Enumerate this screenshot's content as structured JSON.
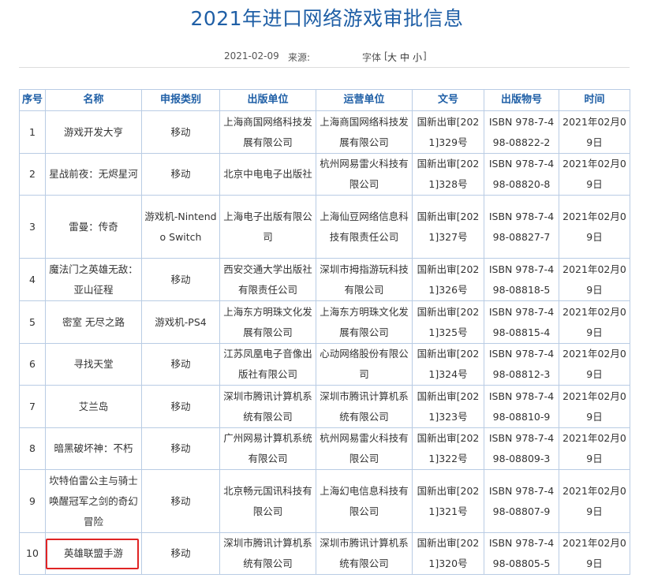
{
  "article": {
    "title": "2021年进口网络游戏审批信息",
    "date": "2021-02-09",
    "source_label": "来源:",
    "font_label": "字体",
    "font_open": "[",
    "font_large": "大",
    "font_medium": "中",
    "font_small": "小",
    "font_close": "]"
  },
  "table": {
    "headers": [
      "序号",
      "名称",
      "申报类别",
      "出版单位",
      "运营单位",
      "文号",
      "出版物号",
      "时间"
    ],
    "rows": [
      [
        "1",
        "游戏开发大亨",
        "移动",
        "上海商国网络科技发展有限公司",
        "上海商国网络科技发展有限公司",
        "国新出审[2021]329号",
        "ISBN 978-7-498-08822-2",
        "2021年02月09日"
      ],
      [
        "2",
        "星战前夜：无烬星河",
        "移动",
        "北京中电电子出版社",
        "杭州网易雷火科技有限公司",
        "国新出审[2021]328号",
        "ISBN 978-7-498-08820-8",
        "2021年02月09日"
      ],
      [
        "3",
        "雷曼：传奇",
        "游戏机-Nintendo Switch",
        "上海电子出版有限公司",
        "上海仙豆网络信息科技有限责任公司",
        "国新出审[2021]327号",
        "ISBN 978-7-498-08827-7",
        "2021年02月09日"
      ],
      [
        "4",
        "魔法门之英雄无敌：亚山征程",
        "移动",
        "西安交通大学出版社有限责任公司",
        "深圳市拇指游玩科技有限公司",
        "国新出审[2021]326号",
        "ISBN 978-7-498-08818-5",
        "2021年02月09日"
      ],
      [
        "5",
        "密室 无尽之路",
        "游戏机-PS4",
        "上海东方明珠文化发展有限公司",
        "上海东方明珠文化发展有限公司",
        "国新出审[2021]325号",
        "ISBN 978-7-498-08815-4",
        "2021年02月09日"
      ],
      [
        "6",
        "寻找天堂",
        "移动",
        "江苏凤凰电子音像出版社有限公司",
        "心动网络股份有限公司",
        "国新出审[2021]324号",
        "ISBN 978-7-498-08812-3",
        "2021年02月09日"
      ],
      [
        "7",
        "艾兰岛",
        "移动",
        "深圳市腾讯计算机系统有限公司",
        "深圳市腾讯计算机系统有限公司",
        "国新出审[2021]323号",
        "ISBN 978-7-498-08810-9",
        "2021年02月09日"
      ],
      [
        "8",
        "暗黑破坏神：不朽",
        "移动",
        "广州网易计算机系统有限公司",
        "杭州网易雷火科技有限公司",
        "国新出审[2021]322号",
        "ISBN 978-7-498-08809-3",
        "2021年02月09日"
      ],
      [
        "9",
        "坎特伯雷公主与骑士唤醒冠军之剑的奇幻冒险",
        "移动",
        "北京畅元国讯科技有限公司",
        "上海幻电信息科技有限公司",
        "国新出审[2021]321号",
        "ISBN 978-7-498-08807-9",
        "2021年02月09日"
      ],
      [
        "10",
        "英雄联盟手游",
        "移动",
        "深圳市腾讯计算机系统有限公司",
        "深圳市腾讯计算机系统有限公司",
        "国新出审[2021]320号",
        "ISBN 978-7-498-08805-5",
        "2021年02月09日"
      ]
    ]
  }
}
